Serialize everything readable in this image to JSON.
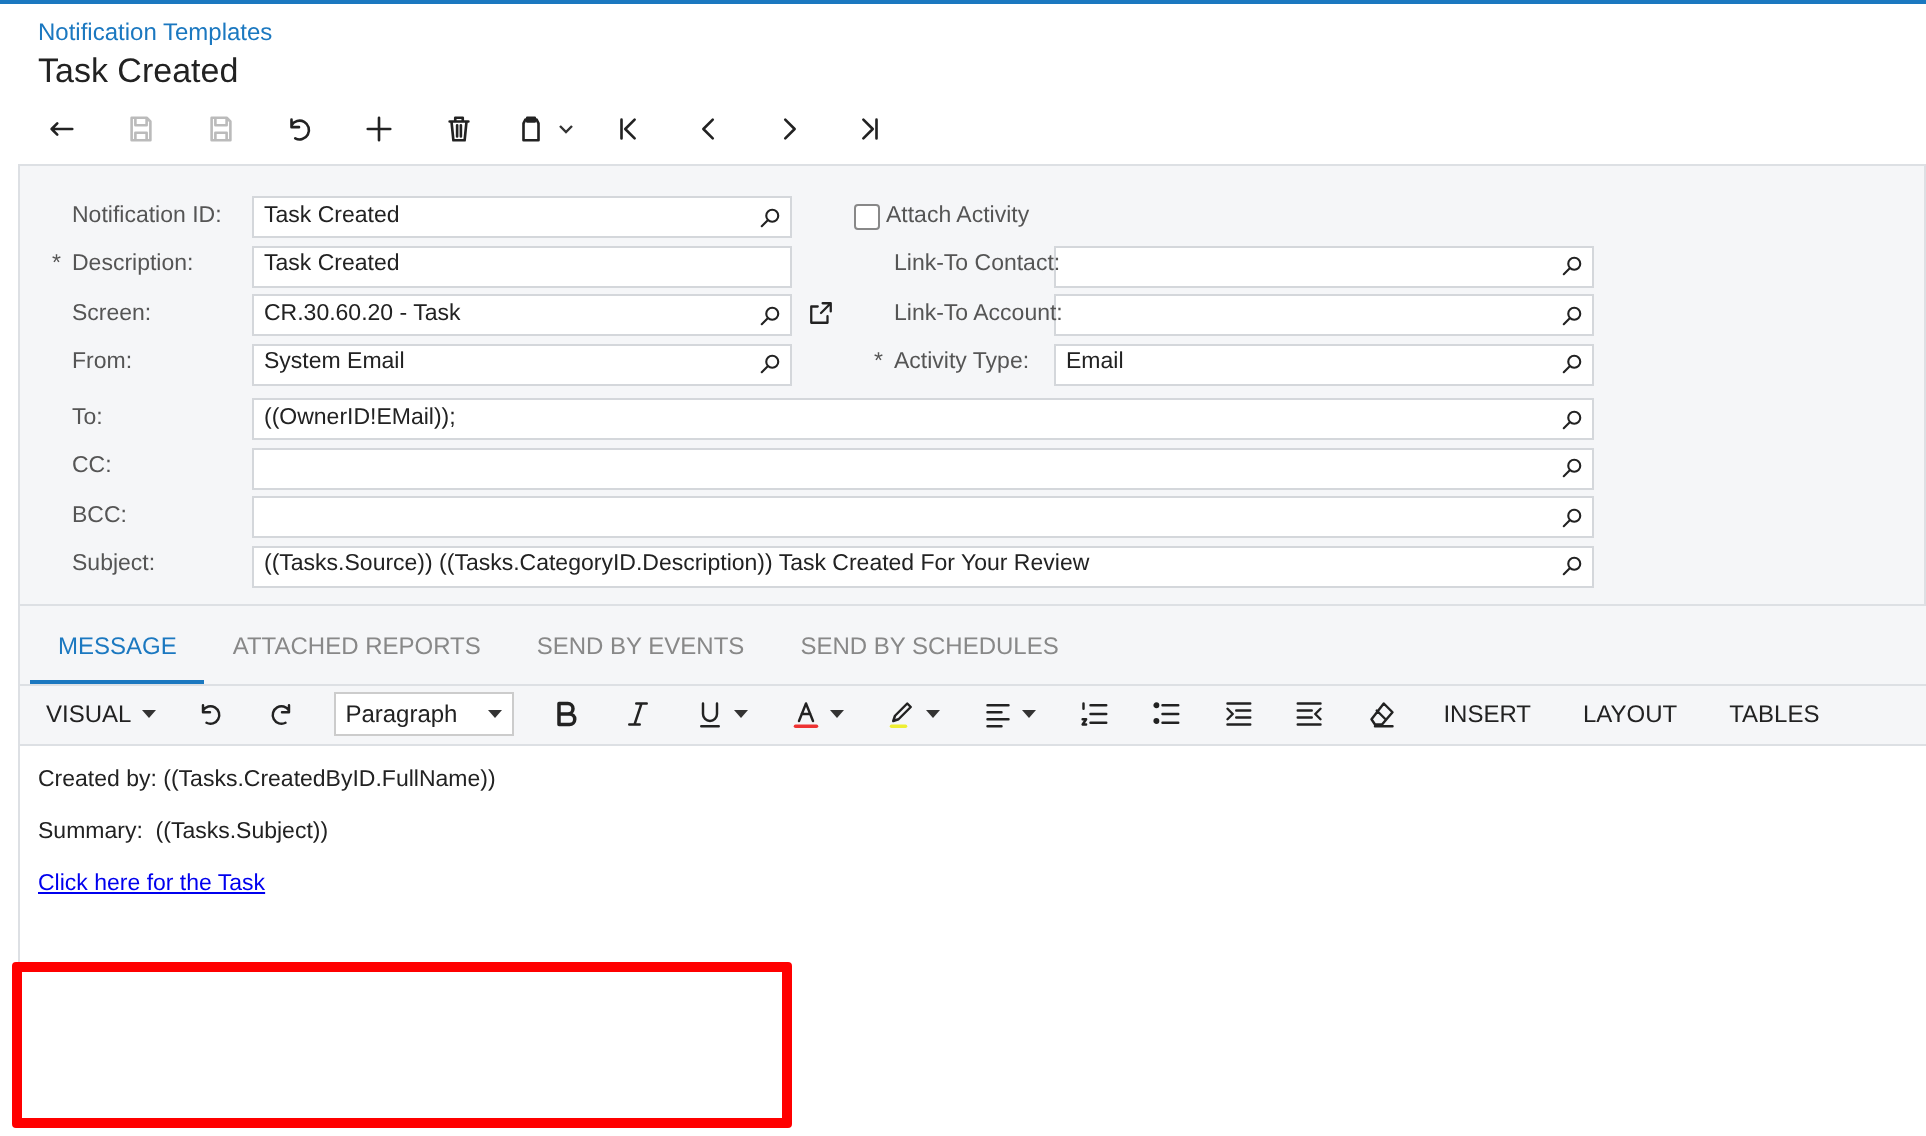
{
  "breadcrumb": "Notification Templates",
  "title": "Task Created",
  "toolbar": [
    {
      "kind": "back",
      "disabled": false
    },
    {
      "kind": "save-close",
      "disabled": true
    },
    {
      "kind": "save",
      "disabled": true
    },
    {
      "kind": "undo",
      "disabled": false
    },
    {
      "kind": "add",
      "disabled": false
    },
    {
      "kind": "delete",
      "disabled": false
    },
    {
      "kind": "clipboard",
      "disabled": false
    },
    {
      "kind": "first",
      "disabled": false
    },
    {
      "kind": "prev",
      "disabled": false
    },
    {
      "kind": "next",
      "disabled": false
    },
    {
      "kind": "last",
      "disabled": false
    }
  ],
  "form": {
    "left_fields": [
      {
        "label": "Notification ID:",
        "value": "Task Created",
        "lookup": true,
        "open_link": false
      },
      {
        "label": "Description:",
        "required_mark": "*",
        "value": "Task Created",
        "lookup": false,
        "open_link": false
      },
      {
        "label": "Screen:",
        "value": "CR.30.60.20 - Task",
        "lookup": true,
        "open_link": true
      },
      {
        "label": "From:",
        "value": "System Email",
        "lookup": true,
        "open_link": false
      }
    ],
    "attach_activity": {
      "label": "Attach Activity",
      "checked": false
    },
    "right_fields": [
      {
        "label": "Link-To Contact:",
        "lookup": true
      },
      {
        "label": "Link-To Account:",
        "lookup": true
      },
      {
        "label": "Activity Type:",
        "required_mark": "*",
        "value": "Email",
        "lookup": true
      }
    ],
    "wide_fields": [
      {
        "label": "To:",
        "value": "((OwnerID!EMail));",
        "lookup": true
      },
      {
        "label": "CC:",
        "lookup": true
      },
      {
        "label": "BCC:",
        "lookup": true
      },
      {
        "label": "Subject:",
        "value": "((Tasks.Source)) ((Tasks.CategoryID.Description)) Task Created For Your Review",
        "lookup": true
      }
    ]
  },
  "tabs": [
    {
      "label": "MESSAGE",
      "selected": true
    },
    {
      "label": "ATTACHED REPORTS",
      "selected": false
    },
    {
      "label": "SEND BY EVENTS",
      "selected": false
    },
    {
      "label": "SEND BY SCHEDULES",
      "selected": false
    }
  ],
  "editor_toolbar": [
    {
      "kind": "menu",
      "label": "VISUAL"
    },
    {
      "kind": "undo"
    },
    {
      "kind": "redo"
    },
    {
      "kind": "select",
      "label": "Paragraph"
    },
    {
      "kind": "bold"
    },
    {
      "kind": "italic"
    },
    {
      "kind": "underline"
    },
    {
      "kind": "font-color"
    },
    {
      "kind": "highlight"
    },
    {
      "kind": "align"
    },
    {
      "kind": "numbered-list"
    },
    {
      "kind": "bullet-list"
    },
    {
      "kind": "indent"
    },
    {
      "kind": "outdent"
    },
    {
      "kind": "eraser"
    },
    {
      "kind": "text",
      "label": "INSERT"
    },
    {
      "kind": "text",
      "label": "LAYOUT"
    },
    {
      "kind": "text",
      "label": "TABLES"
    }
  ],
  "message": [
    {
      "kind": "text",
      "text": "Created by: ((Tasks.CreatedByID.FullName))"
    },
    {
      "kind": "text",
      "text": "Summary:  ((Tasks.Subject))"
    },
    {
      "kind": "link",
      "text": "Click here for the Task"
    }
  ]
}
